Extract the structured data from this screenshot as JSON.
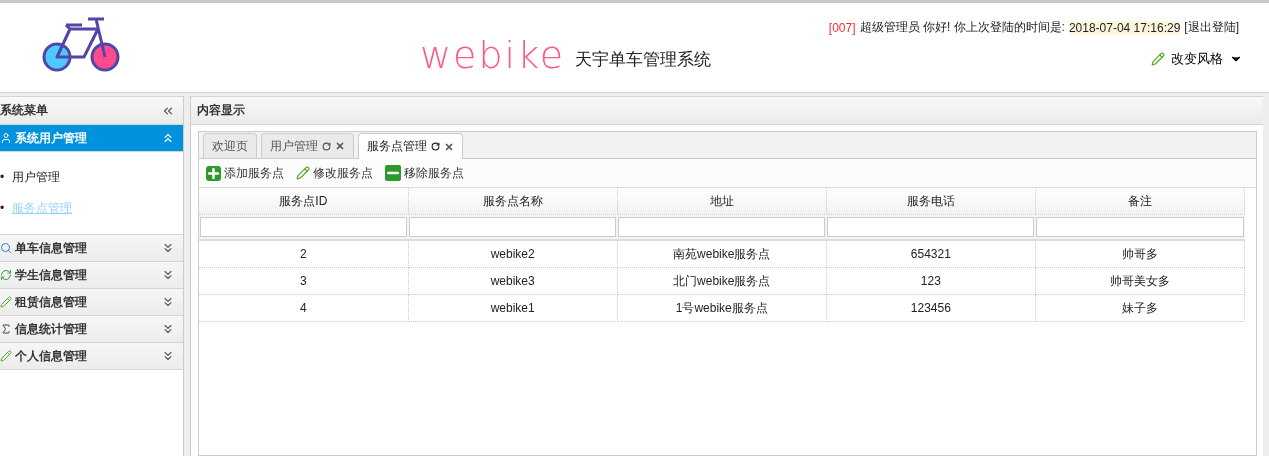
{
  "header": {
    "logo_text": "webike",
    "logo_subtitle": "天宇单车管理系统",
    "user_code": "[007]",
    "greeting": "超级管理员 你好! 你上次登陆的时间是:",
    "last_login": "2018-07-04 17:16:29",
    "logout": "[退出登陆]",
    "theme_button": "改变风格"
  },
  "sidebar": {
    "title": "系统菜单",
    "groups": [
      {
        "label": "系统用户管理",
        "kind": "user",
        "expanded": true,
        "children": [
          {
            "marker": "•",
            "label": "用户管理",
            "selected": false
          },
          {
            "marker": "•",
            "label": "服务点管理",
            "selected": true
          }
        ]
      },
      {
        "label": "单车信息管理",
        "kind": "search",
        "expanded": false
      },
      {
        "label": "学生信息管理",
        "kind": "refresh",
        "expanded": false
      },
      {
        "label": "租赁信息管理",
        "kind": "pencil",
        "expanded": false
      },
      {
        "label": "信息统计管理",
        "kind": "sigma",
        "expanded": false
      },
      {
        "label": "个人信息管理",
        "kind": "pencil",
        "expanded": false
      }
    ]
  },
  "content": {
    "title": "内容显示",
    "tabs": [
      {
        "label": "欢迎页",
        "closable": false,
        "selected": false
      },
      {
        "label": "用户管理",
        "closable": true,
        "selected": false
      },
      {
        "label": "服务点管理",
        "closable": true,
        "selected": true
      }
    ],
    "toolbar": [
      {
        "label": "添加服务点",
        "kind": "add"
      },
      {
        "label": "修改服务点",
        "kind": "edit"
      },
      {
        "label": "移除服务点",
        "kind": "remove"
      }
    ],
    "table": {
      "columns": [
        "服务点ID",
        "服务点名称",
        "地址",
        "服务电话",
        "备注"
      ],
      "rows": [
        [
          "2",
          "webike2",
          "南苑webike服务点",
          "654321",
          "帅哥多"
        ],
        [
          "3",
          "webike3",
          "北门webike服务点",
          "123",
          "帅哥美女多"
        ],
        [
          "4",
          "webike1",
          "1号webike服务点",
          "123456",
          "妹子多"
        ]
      ]
    }
  }
}
